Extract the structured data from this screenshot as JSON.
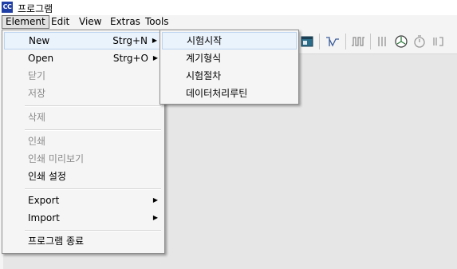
{
  "window": {
    "title": "프로그램",
    "icon_text": "CC"
  },
  "menubar": {
    "items": [
      "Element",
      "Edit",
      "View",
      "Extras",
      "Tools"
    ],
    "active": "Element"
  },
  "element_menu": {
    "items": [
      {
        "label": "New",
        "shortcut": "Strg+N",
        "submenu": true
      },
      {
        "label": "Open",
        "shortcut": "Strg+O",
        "submenu": true
      },
      {
        "label": "닫기"
      },
      {
        "label": "저장"
      },
      {
        "label": "삭제"
      },
      {
        "label": "인쇄"
      },
      {
        "label": "인쇄 미리보기"
      },
      {
        "label": "인쇄 설정"
      },
      {
        "label": "Export",
        "submenu": true
      },
      {
        "label": "Import",
        "submenu": true
      },
      {
        "label": "프로그램 종료"
      }
    ]
  },
  "new_submenu": {
    "items": [
      "시험시작",
      "계기형식",
      "시험절차",
      "데이터처리루틴"
    ]
  },
  "toolbar": {
    "icons": [
      "table-icon",
      "waveform-icon",
      "signal-icon",
      "grid-icon",
      "chart-icon",
      "clock-icon",
      "connector-icon"
    ]
  },
  "colors": {
    "menu_bg": "#f5f5f5",
    "hover_bg": "#eaf2fb",
    "hover_border": "#bcd4ee",
    "workspace": "#e6e6e6",
    "disabled_text": "#8a8a8a"
  }
}
